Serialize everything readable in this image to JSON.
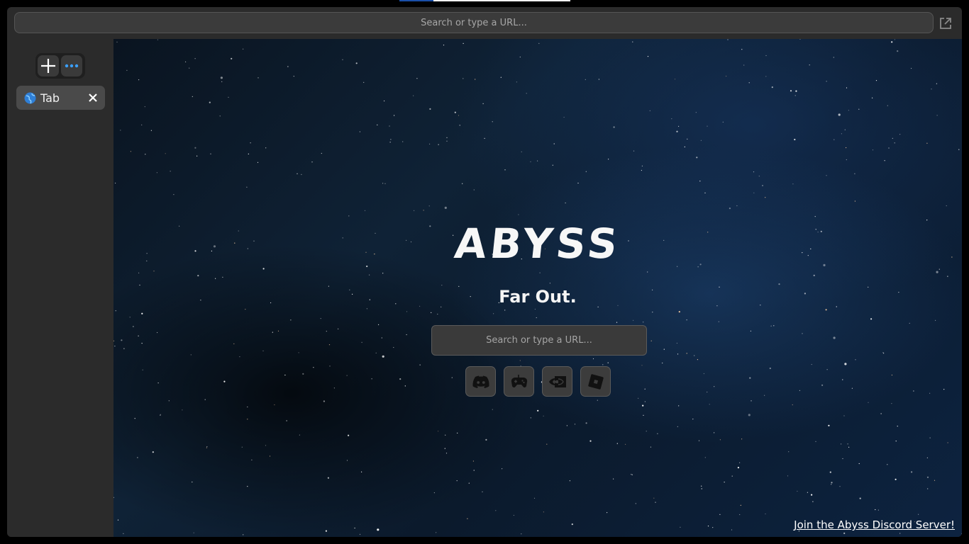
{
  "address_bar": {
    "placeholder": "Search or type a URL..."
  },
  "sidebar": {
    "new_tab_icon": "plus-icon",
    "menu_icon": "ellipsis-icon",
    "tabs": [
      {
        "label": "Tab",
        "icon": "globe-icon",
        "close_icon": "close-icon"
      }
    ]
  },
  "home": {
    "logo": "ABYSS",
    "tagline": "Far Out.",
    "search_placeholder": "Search or type a URL...",
    "shortcuts": [
      {
        "icon": "discord-icon"
      },
      {
        "icon": "gamepad-icon"
      },
      {
        "icon": "nvidia-icon"
      },
      {
        "icon": "roblox-icon"
      }
    ],
    "discord_link": "Join the Abyss Discord Server!"
  },
  "colors": {
    "accent_blue": "#3aa0ff",
    "window_bg": "#2b2b2b",
    "tab_bg": "#4a4a4a"
  }
}
